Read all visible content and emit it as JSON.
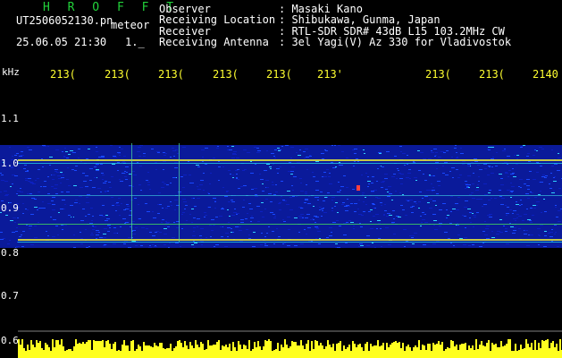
{
  "header": {
    "title": "H R O F F T",
    "filename": "UT2506052130.pn",
    "tag": "meteor",
    "datetime": "25.06.05 21:30",
    "flag": "1._"
  },
  "meta": [
    {
      "label": "Observer",
      "value": ": Masaki Kano"
    },
    {
      "label": "Receiving Location",
      "value": ": Shibukawa, Gunma, Japan"
    },
    {
      "label": "Receiver",
      "value": ": RTL-SDR SDR# 43dB L15 103.2MHz CW"
    },
    {
      "label": "Receiving Antenna",
      "value": ": 3el Yagi(V) Az 330 for Vladivostok"
    }
  ],
  "axis": {
    "x_unit": "kHz",
    "x_ticks": [
      "213(",
      "213(",
      "213(",
      "213(",
      "213(",
      "213'",
      "213(",
      "213(",
      "2140"
    ],
    "y_ticks": [
      "1.1",
      "1.0",
      "0.9",
      "0.8",
      "0.7",
      "0.6"
    ]
  },
  "colors": {
    "background": "#000000",
    "noise_floor": "#1030d0",
    "signal_line": "#e8e838",
    "ticks": "#ffff30",
    "amplitude": "#ffff20"
  }
}
